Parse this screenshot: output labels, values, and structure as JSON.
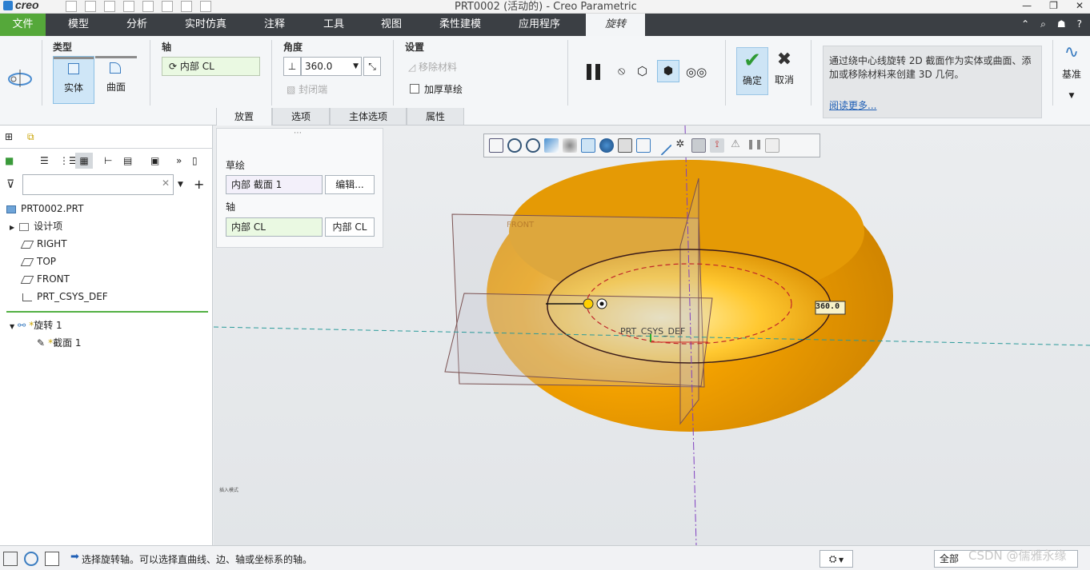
{
  "app": {
    "logo": "creo",
    "window_title": "PRT0002 (活动的) - Creo Parametric"
  },
  "menu": {
    "tabs": [
      "文件",
      "模型",
      "分析",
      "实时仿真",
      "注释",
      "工具",
      "视图",
      "柔性建模",
      "应用程序",
      "旋转"
    ],
    "active_tab": "旋转"
  },
  "ribbon": {
    "type_group": {
      "label": "类型",
      "solid": "实体",
      "surface": "曲面"
    },
    "axis_group": {
      "label": "轴",
      "value": "内部 CL"
    },
    "angle_group": {
      "label": "角度",
      "value": "360.0",
      "capped_ends": "封闭端"
    },
    "settings_group": {
      "label": "设置",
      "remove_material": "移除材料",
      "thicken_sketch": "加厚草绘"
    },
    "ok": "确定",
    "cancel": "取消",
    "help_text": "通过绕中心线旋转 2D 截面作为实体或曲面、添加或移除材料来创建 3D 几何。",
    "help_link": "阅读更多...",
    "datum": "基准",
    "subtabs": [
      "放置",
      "选项",
      "主体选项",
      "属性"
    ],
    "active_subtab": "放置"
  },
  "placement_panel": {
    "sketch_label": "草绘",
    "sketch_value": "内部 截面 1",
    "edit_button": "编辑...",
    "axis_label": "轴",
    "axis_value": "内部 CL",
    "axis_button": "内部 CL"
  },
  "model_tree": {
    "root": "PRT0002.PRT",
    "items": [
      {
        "label": "设计项",
        "icon": "design-items-icon"
      },
      {
        "label": "RIGHT",
        "icon": "datum-plane-icon"
      },
      {
        "label": "TOP",
        "icon": "datum-plane-icon"
      },
      {
        "label": "FRONT",
        "icon": "datum-plane-icon"
      },
      {
        "label": "PRT_CSYS_DEF",
        "icon": "csys-icon"
      }
    ],
    "feature": "旋转 1",
    "sub_feature": "截面 1"
  },
  "graphics": {
    "angle_dim": "360.0",
    "csys_label": "PRT_CSYS_DEF",
    "plane_label": "FRONT",
    "tiny_text": "插入模式"
  },
  "colors": {
    "torus": "#f0a000",
    "torus_dark": "#c77f00",
    "file_tab": "#55a83a",
    "menubar": "#3b3f44"
  },
  "statusbar": {
    "message": "选择旋转轴。可以选择直曲线、边、轴或坐标系的轴。",
    "filter_value": "全部"
  },
  "watermark": "CSDN @儒雅永缘"
}
